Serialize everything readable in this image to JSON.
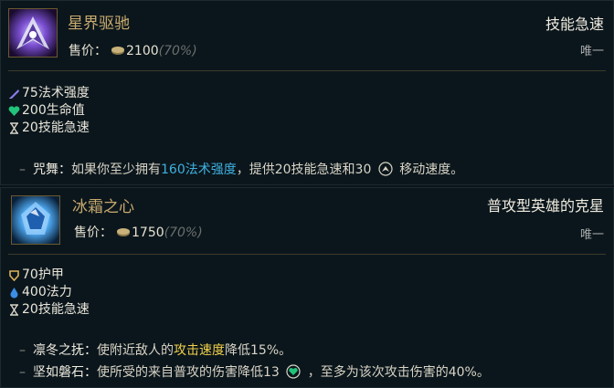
{
  "item1": {
    "name": "星界驱驰",
    "price_label": "售价：",
    "price": "2100",
    "percent": "(70%)",
    "tag": "技能急速",
    "unique": "唯一",
    "stats": [
      {
        "icon": "ability-power-icon",
        "text": "75法术强度"
      },
      {
        "icon": "health-icon",
        "text": "200生命值"
      },
      {
        "icon": "ability-haste-icon",
        "text": "20技能急速"
      }
    ],
    "passive": {
      "dash": "–",
      "name": "咒舞：",
      "text1": "如果你至少拥有",
      "highlight": "160法术强度",
      "text2": "，提供20技能急速和30",
      "text3": "移动速度。"
    }
  },
  "item2": {
    "name": "冰霜之心",
    "price_label": "售价：",
    "price": "1750",
    "percent": "(70%)",
    "tag": "普攻型英雄的克星",
    "unique": "唯一",
    "stats": [
      {
        "icon": "armor-icon",
        "text": "70护甲"
      },
      {
        "icon": "mana-icon",
        "text": "400法力"
      },
      {
        "icon": "ability-haste-icon",
        "text": "20技能急速"
      }
    ],
    "passive1": {
      "dash": "–",
      "name": "凛冬之抚：",
      "text1": "使附近敌人的",
      "highlight": "攻击速度",
      "text2": "降低15%。"
    },
    "passive2": {
      "dash": "–",
      "name": "坚如磐石：",
      "text1": "使所受的来自普攻的伤害降低13",
      "text2": "，至多为该次攻击伤害的40%。"
    }
  },
  "colors": {
    "gold": "#c8aa6e",
    "ap_blue": "#3fb0e0",
    "attack_speed_yellow": "#f1d04a",
    "health_green": "#22c37a",
    "mana_blue": "#3a8ee6"
  }
}
